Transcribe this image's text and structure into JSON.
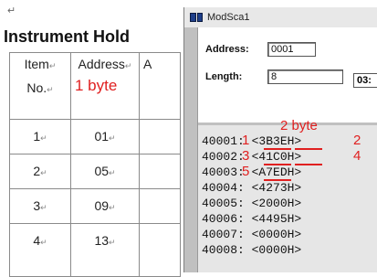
{
  "document": {
    "para_mark": "↵",
    "title": "Instrument Hold",
    "table": {
      "headers": [
        {
          "text": "Item",
          "line2": "No."
        },
        {
          "text": "Address"
        },
        {
          "text": "A"
        }
      ],
      "rows": [
        {
          "item": "1",
          "address": "01"
        },
        {
          "item": "2",
          "address": "05"
        },
        {
          "item": "3",
          "address": "09"
        },
        {
          "item": "4",
          "address": "13"
        }
      ]
    },
    "annotation_1byte": "1 byte"
  },
  "window": {
    "title": "ModSca1",
    "address_label": "Address:",
    "address_value": "0001",
    "length_label": "Length:",
    "length_value": "8",
    "device_id": "03:",
    "annotation_2byte": "2 byte",
    "annotation_numbers": [
      "1",
      "2",
      "3",
      "4",
      "5"
    ],
    "registers": [
      {
        "addr": "40001:",
        "value": "<3B3EH>"
      },
      {
        "addr": "40002:",
        "value": "<41C0H>"
      },
      {
        "addr": "40003:",
        "value": "<A7EDH>"
      },
      {
        "addr": "40004:",
        "value": "<4273H>"
      },
      {
        "addr": "40005:",
        "value": "<2000H>"
      },
      {
        "addr": "40006:",
        "value": "<4495H>"
      },
      {
        "addr": "40007:",
        "value": "<0000H>"
      },
      {
        "addr": "40008:",
        "value": "<0000H>"
      }
    ]
  }
}
